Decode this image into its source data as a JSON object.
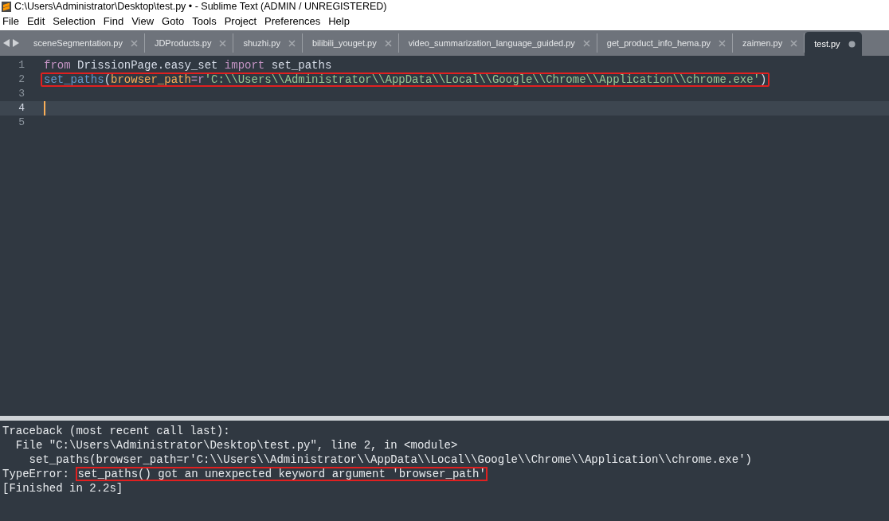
{
  "window": {
    "title": "C:\\Users\\Administrator\\Desktop\\test.py • - Sublime Text (ADMIN / UNREGISTERED)"
  },
  "menu": [
    {
      "label": "File"
    },
    {
      "label": "Edit"
    },
    {
      "label": "Selection"
    },
    {
      "label": "Find"
    },
    {
      "label": "View"
    },
    {
      "label": "Goto"
    },
    {
      "label": "Tools"
    },
    {
      "label": "Project"
    },
    {
      "label": "Preferences"
    },
    {
      "label": "Help"
    }
  ],
  "tabs": [
    {
      "label": "sceneSegmentation.py",
      "selected": false,
      "modified": false
    },
    {
      "label": "JDProducts.py",
      "selected": false,
      "modified": false
    },
    {
      "label": "shuzhi.py",
      "selected": false,
      "modified": false
    },
    {
      "label": "bilibili_youget.py",
      "selected": false,
      "modified": false
    },
    {
      "label": "video_summarization_language_guided.py",
      "selected": false,
      "modified": false
    },
    {
      "label": "get_product_info_hema.py",
      "selected": false,
      "modified": false
    },
    {
      "label": "zaimen.py",
      "selected": false,
      "modified": false
    },
    {
      "label": "test.py",
      "selected": true,
      "modified": true
    }
  ],
  "editor": {
    "lines": [
      {
        "number": "1",
        "current": false,
        "highlighted": false,
        "tokens": [
          {
            "text": "from",
            "kind": "keyword"
          },
          {
            "text": " DrissionPage.easy_set ",
            "kind": "plain"
          },
          {
            "text": "import",
            "kind": "keyword"
          },
          {
            "text": " set_paths",
            "kind": "plain"
          }
        ]
      },
      {
        "number": "2",
        "current": false,
        "highlighted": true,
        "tokens": [
          {
            "text": "set_paths",
            "kind": "function"
          },
          {
            "text": "(",
            "kind": "plain"
          },
          {
            "text": "browser_path",
            "kind": "param"
          },
          {
            "text": "=",
            "kind": "keyword"
          },
          {
            "text": "r",
            "kind": "keyword"
          },
          {
            "text": "'C:\\\\Users\\\\Administrator\\\\AppData\\\\Local\\\\Google\\\\Chrome\\\\Application\\\\chrome.exe'",
            "kind": "string"
          },
          {
            "text": ")",
            "kind": "plain"
          }
        ]
      },
      {
        "number": "3",
        "current": false
      },
      {
        "number": "4",
        "current": true
      },
      {
        "number": "5",
        "current": false
      }
    ]
  },
  "output": {
    "lines": [
      {
        "segments": [
          {
            "text": "Traceback (most recent call last):",
            "highlighted": false
          }
        ]
      },
      {
        "segments": [
          {
            "text": "  File \"C:\\Users\\Administrator\\Desktop\\test.py\", line 2, in <module>",
            "highlighted": false
          }
        ]
      },
      {
        "segments": [
          {
            "text": "    set_paths(browser_path=r'C:\\\\Users\\\\Administrator\\\\AppData\\\\Local\\\\Google\\\\Chrome\\\\Application\\\\chrome.exe')",
            "highlighted": false
          }
        ]
      },
      {
        "segments": [
          {
            "text": "TypeError: ",
            "highlighted": false
          },
          {
            "text": "set_paths() got an unexpected keyword argument 'browser_path'",
            "highlighted": true
          }
        ]
      },
      {
        "segments": [
          {
            "text": "[Finished in 2.2s]",
            "highlighted": false
          }
        ]
      }
    ]
  }
}
